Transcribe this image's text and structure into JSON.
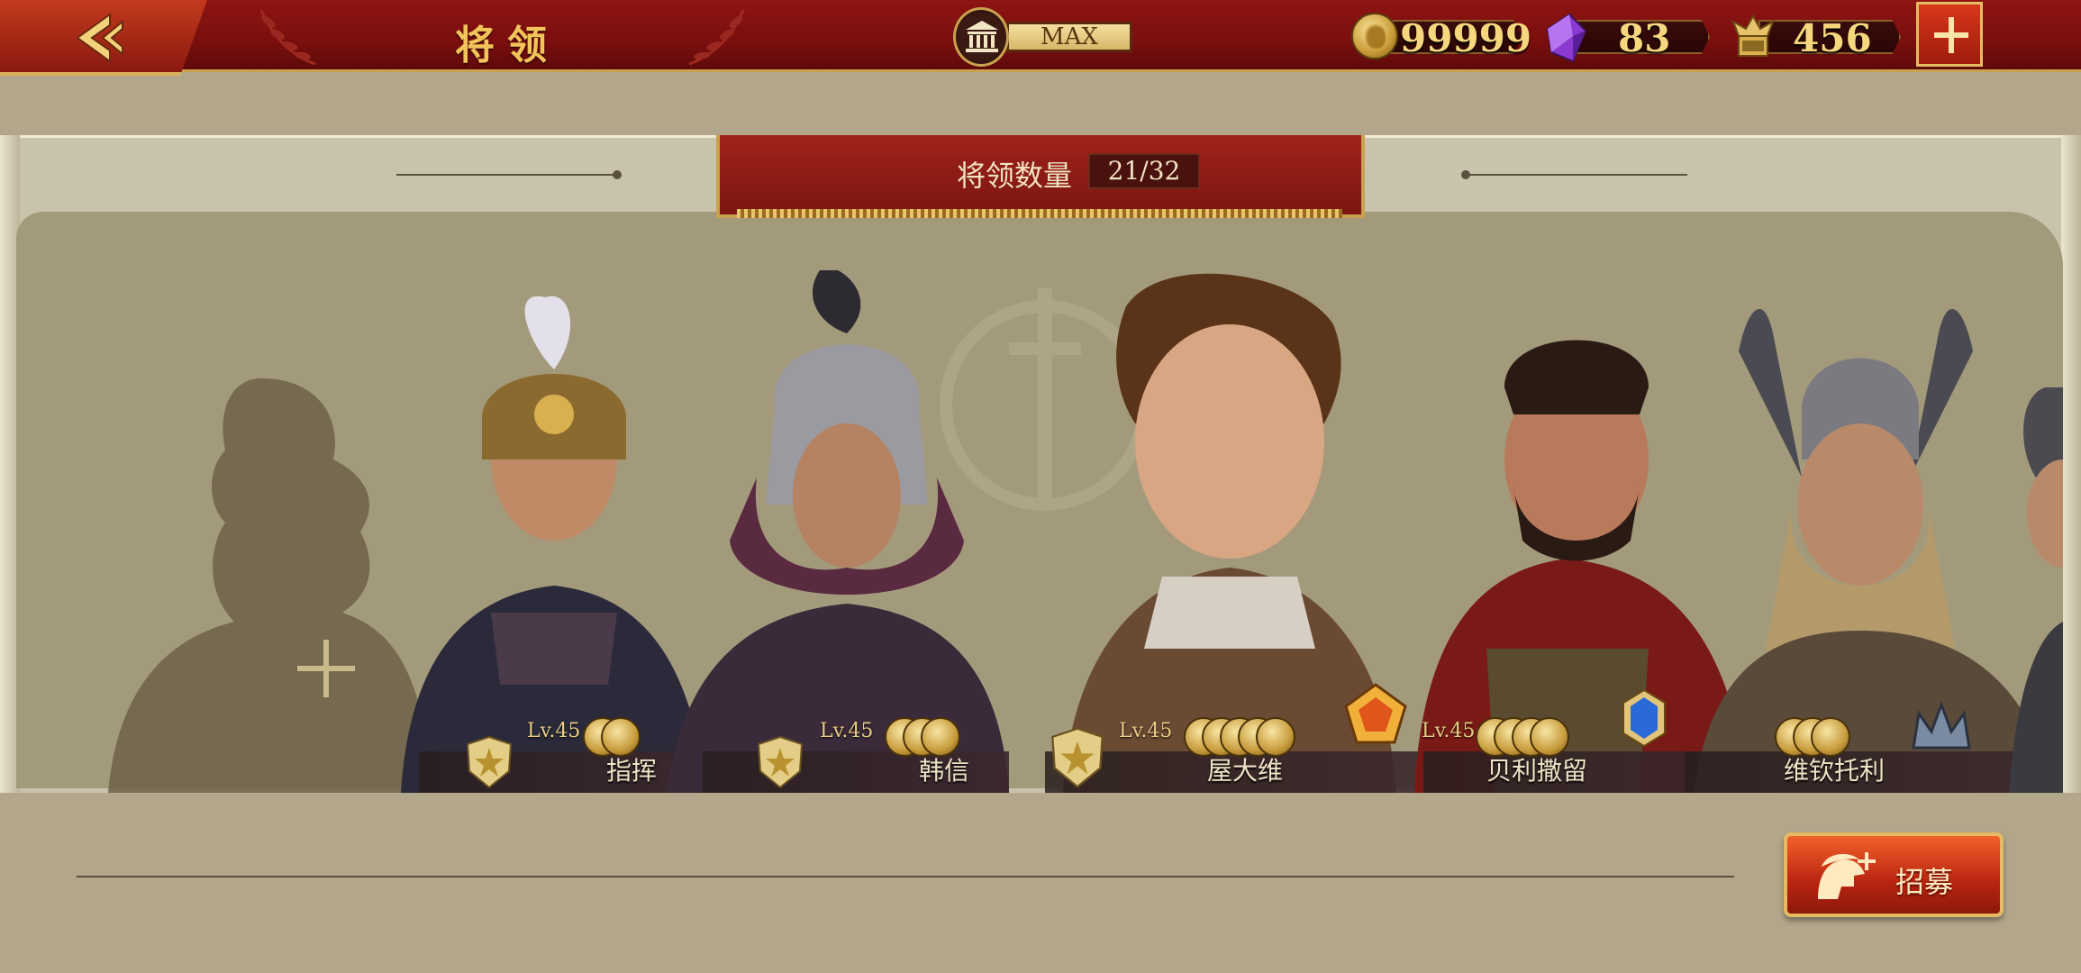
{
  "header": {
    "title": "将领",
    "building_level": "MAX",
    "resources": [
      {
        "icon": "gold-coin-icon",
        "value": "99999"
      },
      {
        "icon": "purple-gem-icon",
        "value": "83"
      },
      {
        "icon": "spqr-eagle-icon",
        "value": "456"
      }
    ]
  },
  "banner": {
    "label": "将领数量",
    "count": "21/32"
  },
  "generals": [
    {
      "name": "指挥",
      "level": "Lv.45"
    },
    {
      "name": "韩信",
      "level": "Lv.45"
    },
    {
      "name": "屋大维",
      "level": "Lv.45"
    },
    {
      "name": "贝利撒留",
      "level": "Lv.45"
    },
    {
      "name": "维钦托利",
      "level": ""
    }
  ],
  "footer": {
    "recruit_label": "招募"
  },
  "colors": {
    "header_red": "#7a0f0e",
    "gold_text": "#f2c55a",
    "panel_tan": "#a39a7c",
    "recruit_orange": "#e0461d"
  }
}
